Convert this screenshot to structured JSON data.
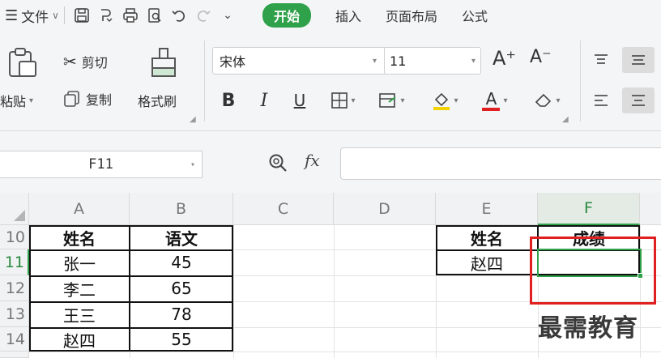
{
  "menubar": {
    "file_label": "文件",
    "tabs": [
      {
        "label": "开始",
        "active": true
      },
      {
        "label": "插入",
        "active": false
      },
      {
        "label": "页面布局",
        "active": false
      },
      {
        "label": "公式",
        "active": false
      }
    ],
    "quick_icons": [
      "save-icon",
      "export-icon",
      "print-icon",
      "print-preview-icon",
      "undo-icon",
      "redo-icon",
      "customize-dropdown-icon"
    ]
  },
  "ribbon": {
    "paste_label": "粘贴",
    "cut_label": "剪切",
    "copy_label": "复制",
    "format_painter_label": "格式刷",
    "font_name": "宋体",
    "font_size": "11",
    "bold": "B",
    "italic": "I",
    "underline": "U",
    "font_color_letter": "A"
  },
  "formula_bar": {
    "name_box": "F11",
    "fx_label": "fx",
    "formula_value": ""
  },
  "sheet": {
    "columns": [
      "A",
      "B",
      "C",
      "D",
      "E",
      "F"
    ],
    "rows": [
      "10",
      "11",
      "12",
      "13",
      "14"
    ],
    "left_table": {
      "headers": [
        "姓名",
        "语文"
      ],
      "rows": [
        [
          "张一",
          "45"
        ],
        [
          "李二",
          "65"
        ],
        [
          "王三",
          "78"
        ],
        [
          "赵四",
          "55"
        ]
      ]
    },
    "right_table": {
      "headers": [
        "姓名",
        "成绩"
      ],
      "rows": [
        [
          "赵四",
          ""
        ]
      ]
    },
    "selected_cell": "F11"
  },
  "watermark": "最需教育",
  "colors": {
    "accent_green": "#2fa14a",
    "highlight_red": "#e02020"
  }
}
